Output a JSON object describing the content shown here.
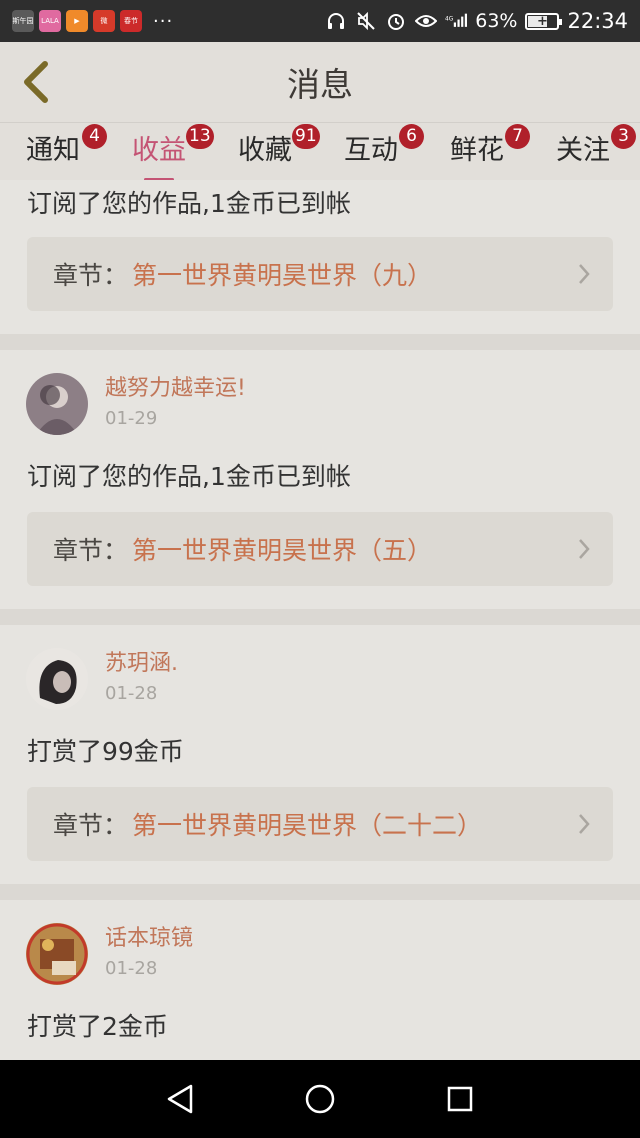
{
  "status_bar": {
    "battery_percent": "63%",
    "time": "22:34",
    "network": "4G",
    "more": "···",
    "app_icons": [
      {
        "name": "app1",
        "color": "#5a5a5a",
        "label": "斯午园"
      },
      {
        "name": "app2",
        "color": "#e06aa0",
        "label": "LALA"
      },
      {
        "name": "app3",
        "color": "#f08a2a",
        "label": "▶"
      },
      {
        "name": "app4",
        "color": "#d63a2a",
        "label": "微"
      },
      {
        "name": "app5",
        "color": "#cc2a2a",
        "label": "春节"
      }
    ]
  },
  "header": {
    "title": "消息"
  },
  "tabs": [
    {
      "label": "通知",
      "badge": "4",
      "active": false
    },
    {
      "label": "收益",
      "badge": "13",
      "active": true
    },
    {
      "label": "收藏",
      "badge": "91",
      "active": false
    },
    {
      "label": "互动",
      "badge": "6",
      "active": false
    },
    {
      "label": "鲜花",
      "badge": "7",
      "active": false
    },
    {
      "label": "关注",
      "badge": "3",
      "active": false
    }
  ],
  "messages": [
    {
      "text": "订阅了您的作品,1金币已到帐",
      "chapter_label": "章节：",
      "chapter_title": "第一世界黄明昊世界（九）"
    },
    {
      "user": "越努力越幸运!",
      "date": "01-29",
      "text": "订阅了您的作品,1金币已到帐",
      "chapter_label": "章节：",
      "chapter_title": "第一世界黄明昊世界（五）"
    },
    {
      "user": "苏玥涵.",
      "date": "01-28",
      "text": "打赏了99金币",
      "chapter_label": "章节：",
      "chapter_title": "第一世界黄明昊世界（二十二）"
    },
    {
      "user": "话本琼镜",
      "date": "01-28",
      "text": "打赏了2金币"
    }
  ],
  "colors": {
    "accent": "#c45474",
    "badge": "#b0202a",
    "username": "#c1775a",
    "chapter_title": "#c8724d"
  }
}
